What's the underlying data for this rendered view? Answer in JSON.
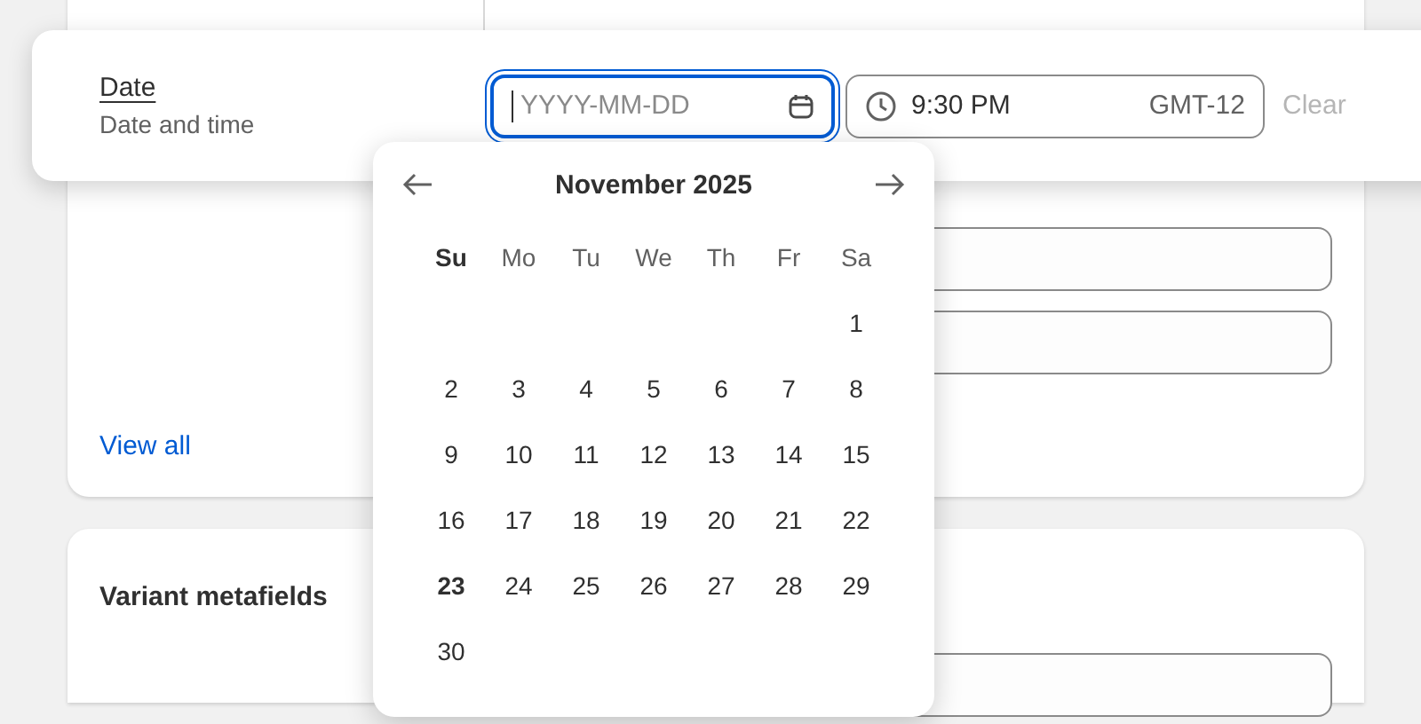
{
  "background": {
    "link": "View all",
    "section_title": "Variant metafields"
  },
  "date_popover": {
    "label": "Date",
    "help": "Date and time",
    "date_field": {
      "placeholder": "YYYY-MM-DD",
      "focused": true
    },
    "time_field": {
      "value": "9:30 PM",
      "timezone": "GMT-12"
    },
    "clear_button": {
      "label": "Clear",
      "disabled": true
    }
  },
  "calendar": {
    "month": "November 2025",
    "weekdays": [
      {
        "label": "Su",
        "current": true
      },
      {
        "label": "Mo",
        "current": false
      },
      {
        "label": "Tu",
        "current": false
      },
      {
        "label": "We",
        "current": false
      },
      {
        "label": "Th",
        "current": false
      },
      {
        "label": "Fr",
        "current": false
      },
      {
        "label": "Sa",
        "current": false
      }
    ],
    "weeks": [
      [
        {
          "day": "1",
          "today": false
        }
      ],
      [
        {
          "day": "2",
          "today": false
        },
        {
          "day": "3",
          "today": false
        },
        {
          "day": "4",
          "today": false
        },
        {
          "day": "5",
          "today": false
        },
        {
          "day": "6",
          "today": false
        },
        {
          "day": "7",
          "today": false
        },
        {
          "day": "8",
          "today": false
        }
      ],
      [
        {
          "day": "9",
          "today": false
        },
        {
          "day": "10",
          "today": false
        },
        {
          "day": "11",
          "today": false
        },
        {
          "day": "12",
          "today": false
        },
        {
          "day": "13",
          "today": false
        },
        {
          "day": "14",
          "today": false
        },
        {
          "day": "15",
          "today": false
        }
      ],
      [
        {
          "day": "16",
          "today": false
        },
        {
          "day": "17",
          "today": false
        },
        {
          "day": "18",
          "today": false
        },
        {
          "day": "19",
          "today": false
        },
        {
          "day": "20",
          "today": false
        },
        {
          "day": "21",
          "today": false
        },
        {
          "day": "22",
          "today": false
        }
      ],
      [
        {
          "day": "23",
          "today": true
        },
        {
          "day": "24",
          "today": false
        },
        {
          "day": "25",
          "today": false
        },
        {
          "day": "26",
          "today": false
        },
        {
          "day": "27",
          "today": false
        },
        {
          "day": "28",
          "today": false
        },
        {
          "day": "29",
          "today": false
        }
      ],
      [
        {
          "day": "30",
          "today": false
        }
      ]
    ]
  }
}
